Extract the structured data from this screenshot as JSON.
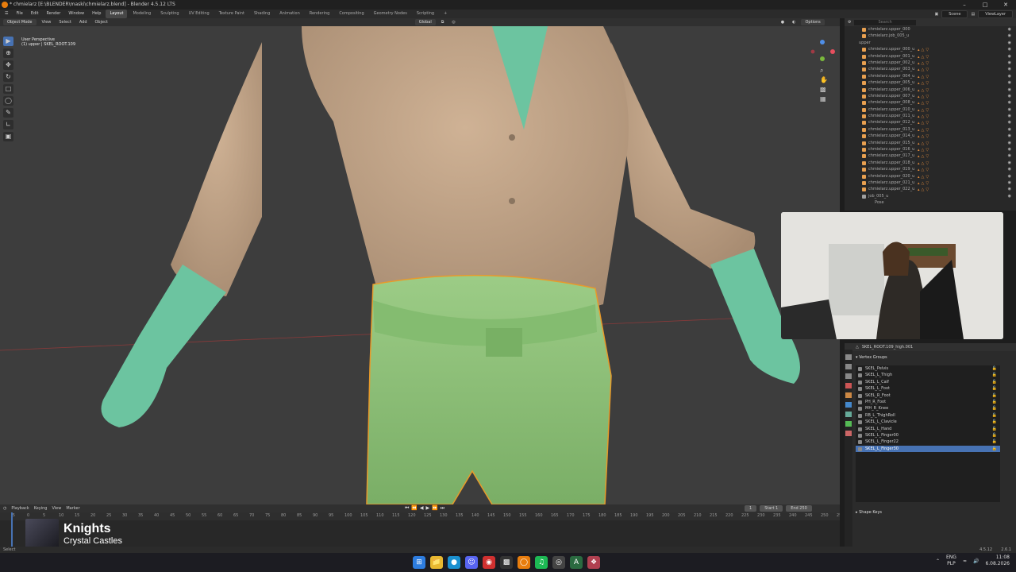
{
  "window": {
    "title": "* chmielarz [E:\\BLENDER\\maski\\chmielarz.blend] - Blender 4.5.12 LTS",
    "min": "–",
    "max": "□",
    "close": "✕"
  },
  "menu": [
    "File",
    "Edit",
    "Render",
    "Window",
    "Help"
  ],
  "workspaces": [
    "Layout",
    "Modeling",
    "Sculpting",
    "UV Editing",
    "Texture Paint",
    "Shading",
    "Animation",
    "Rendering",
    "Compositing",
    "Geometry Nodes",
    "Scripting",
    "+"
  ],
  "topright": {
    "scene": "Scene",
    "viewlayer": "ViewLayer"
  },
  "vp_header": {
    "mode": "Object Mode",
    "view": "View",
    "select": "Select",
    "add": "Add",
    "object": "Object",
    "orientation": "Global",
    "options": "Options"
  },
  "viewport_info": {
    "line1": "User Perspective",
    "line2": "(1) upper | SKEL_ROOT.109"
  },
  "outliner": {
    "search_placeholder": "Search",
    "rows": [
      "chmielarz.upper_000",
      "chmielarz.job_005_u",
      "upper",
      "chmielarz.upper_000_u",
      "chmielarz.upper_001_u",
      "chmielarz.upper_002_u",
      "chmielarz.upper_003_u",
      "chmielarz.upper_004_u",
      "chmielarz.upper_005_u",
      "chmielarz.upper_006_u",
      "chmielarz.upper_007_u",
      "chmielarz.upper_008_u",
      "chmielarz.upper_010_u",
      "chmielarz.upper_011_u",
      "chmielarz.upper_012_u",
      "chmielarz.upper_013_u",
      "chmielarz.upper_014_u",
      "chmielarz.upper_015_u",
      "chmielarz.upper_016_u",
      "chmielarz.upper_017_u",
      "chmielarz.upper_018_u",
      "chmielarz.upper_019_u",
      "chmielarz.upper_020_u",
      "chmielarz.upper_021_u",
      "chmielarz.upper_022_u",
      "job_005_u",
      "Pose"
    ]
  },
  "props": {
    "object": "SKEL_ROOT.109_high.001",
    "vg_header": "Vertex Groups",
    "vertex_groups": [
      "SKEL_Pelvis",
      "SKEL_L_Thigh",
      "SKEL_L_Calf",
      "SKEL_L_Foot",
      "SKEL_R_Foot",
      "PH_R_Foot",
      "MH_R_Knee",
      "RB_L_ThighRoll",
      "SKEL_L_Clavicle",
      "SKEL_L_Hand",
      "SKEL_L_Finger00",
      "SKEL_L_Finger22",
      "SKEL_L_Finger30"
    ],
    "selected_index": 12,
    "shape_keys": "Shape Keys"
  },
  "timeline": {
    "playback": "Playback",
    "keying": "Keying",
    "view": "View",
    "marker": "Marker",
    "current": "1",
    "start_label": "Start",
    "start": "1",
    "end_label": "End",
    "end": "250",
    "ticks": [
      "-5",
      "0",
      "5",
      "10",
      "15",
      "20",
      "25",
      "30",
      "35",
      "40",
      "45",
      "50",
      "55",
      "60",
      "65",
      "70",
      "75",
      "80",
      "85",
      "90",
      "95",
      "100",
      "105",
      "110",
      "115",
      "120",
      "125",
      "130",
      "135",
      "140",
      "145",
      "150",
      "155",
      "160",
      "165",
      "170",
      "175",
      "180",
      "185",
      "190",
      "195",
      "200",
      "205",
      "210",
      "215",
      "220",
      "225",
      "230",
      "235",
      "240",
      "245",
      "250",
      "255"
    ]
  },
  "music": {
    "title": "Knights",
    "artist": "Crystal Castles"
  },
  "statusbar": {
    "left": "Select",
    "version": "4.5.12",
    "right": "2.6.1"
  },
  "tray": {
    "lang1": "ENG",
    "lang2": "PLP",
    "time": "11:08",
    "date": "6.08.2026"
  },
  "colors": {
    "accent": "#4772b3",
    "orange": "#e87d0d",
    "shirt": "#c4a488",
    "pants": "#8fc07a",
    "skin": "#6cc4a0"
  }
}
